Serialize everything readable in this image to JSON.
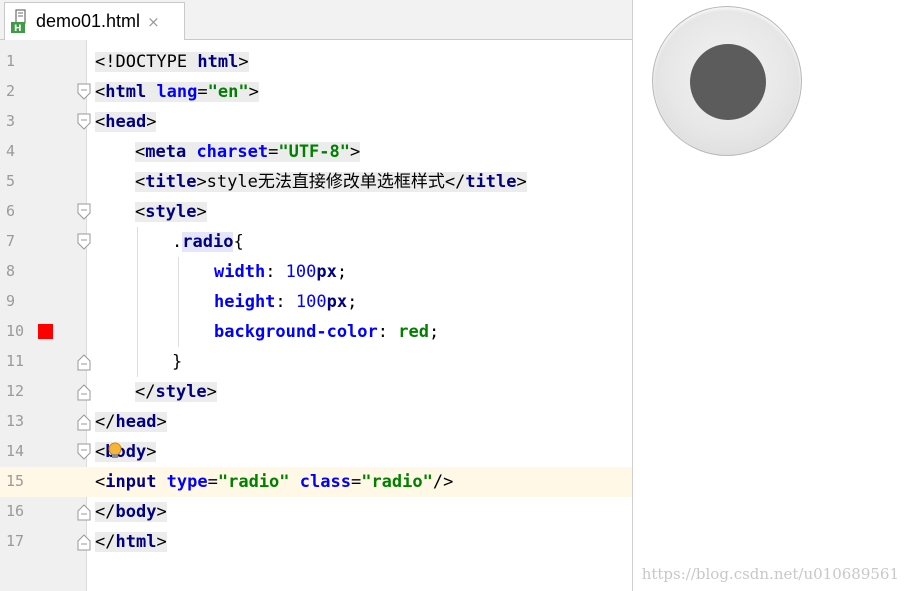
{
  "tab": {
    "label": "demo01.html",
    "icon": "html-file-icon",
    "close": "×"
  },
  "code_lines": [
    {
      "n": "1",
      "segments": [
        [
          "p",
          "<!DOCTYPE "
        ],
        [
          "k",
          "html"
        ],
        [
          "p",
          ">"
        ]
      ]
    },
    {
      "n": "2",
      "segments": [
        [
          "p",
          "<"
        ],
        [
          "k",
          "html "
        ],
        [
          "a",
          "lang"
        ],
        [
          "p",
          "="
        ],
        [
          "s",
          "\"en\""
        ],
        [
          "p",
          ">"
        ]
      ]
    },
    {
      "n": "3",
      "segments": [
        [
          "p",
          "<"
        ],
        [
          "k",
          "head"
        ],
        [
          "p",
          ">"
        ]
      ]
    },
    {
      "n": "4",
      "segments": [
        [
          "p",
          "<"
        ],
        [
          "k",
          "meta "
        ],
        [
          "a",
          "charset"
        ],
        [
          "p",
          "="
        ],
        [
          "s",
          "\"UTF-8\""
        ],
        [
          "p",
          ">"
        ]
      ]
    },
    {
      "n": "5",
      "segments": [
        [
          "p",
          "<"
        ],
        [
          "k",
          "title"
        ],
        [
          "p",
          ">style无法直接修改单选框样式</"
        ],
        [
          "k",
          "title"
        ],
        [
          "p",
          ">"
        ]
      ]
    },
    {
      "n": "6",
      "segments": [
        [
          "p",
          "<"
        ],
        [
          "k",
          "style"
        ],
        [
          "p",
          ">"
        ]
      ]
    },
    {
      "n": "7",
      "segments": [
        [
          "p",
          "."
        ],
        [
          "k",
          "radio"
        ],
        [
          "p",
          "{"
        ]
      ]
    },
    {
      "n": "8",
      "segments": [
        [
          "a",
          "width"
        ],
        [
          "p",
          ": "
        ],
        [
          "n",
          "100"
        ],
        [
          "k",
          "px"
        ],
        [
          "p",
          ";"
        ]
      ]
    },
    {
      "n": "9",
      "segments": [
        [
          "a",
          "height"
        ],
        [
          "p",
          ": "
        ],
        [
          "n",
          "100"
        ],
        [
          "k",
          "px"
        ],
        [
          "p",
          ";"
        ]
      ]
    },
    {
      "n": "10",
      "segments": [
        [
          "a",
          "background-color"
        ],
        [
          "p",
          ": "
        ],
        [
          "s",
          "red"
        ],
        [
          "p",
          ";"
        ]
      ]
    },
    {
      "n": "11",
      "segments": [
        [
          "p",
          "}"
        ]
      ]
    },
    {
      "n": "12",
      "segments": [
        [
          "p",
          "</"
        ],
        [
          "k",
          "style"
        ],
        [
          "p",
          ">"
        ]
      ]
    },
    {
      "n": "13",
      "segments": [
        [
          "p",
          "</"
        ],
        [
          "k",
          "head"
        ],
        [
          "p",
          ">"
        ]
      ]
    },
    {
      "n": "14",
      "segments": [
        [
          "p",
          "<"
        ],
        [
          "k",
          "body"
        ],
        [
          "p",
          ">"
        ]
      ]
    },
    {
      "n": "15",
      "segments": [
        [
          "p",
          "<"
        ],
        [
          "k",
          "input "
        ],
        [
          "a",
          "type"
        ],
        [
          "p",
          "="
        ],
        [
          "s",
          "\"radio\" "
        ],
        [
          "a",
          "class"
        ],
        [
          "p",
          "="
        ],
        [
          "s",
          "\"radio\""
        ],
        [
          "p",
          "/>"
        ]
      ]
    },
    {
      "n": "16",
      "segments": [
        [
          "p",
          "</"
        ],
        [
          "k",
          "body"
        ],
        [
          "p",
          ">"
        ]
      ]
    },
    {
      "n": "17",
      "segments": [
        [
          "p",
          "</"
        ],
        [
          "k",
          "html"
        ],
        [
          "p",
          ">"
        ]
      ]
    }
  ],
  "current_line": "15",
  "breakpoint_line": "10",
  "preview": {
    "radio_checked": true
  },
  "watermark": "https://blog.csdn.net/u010689561",
  "colors": {
    "tag": "#000080",
    "attr": "#0000ff",
    "string": "#008000",
    "number": "#0000ff",
    "breakpoint": "#ff0000",
    "current_line_bg": "#fff8e6"
  }
}
